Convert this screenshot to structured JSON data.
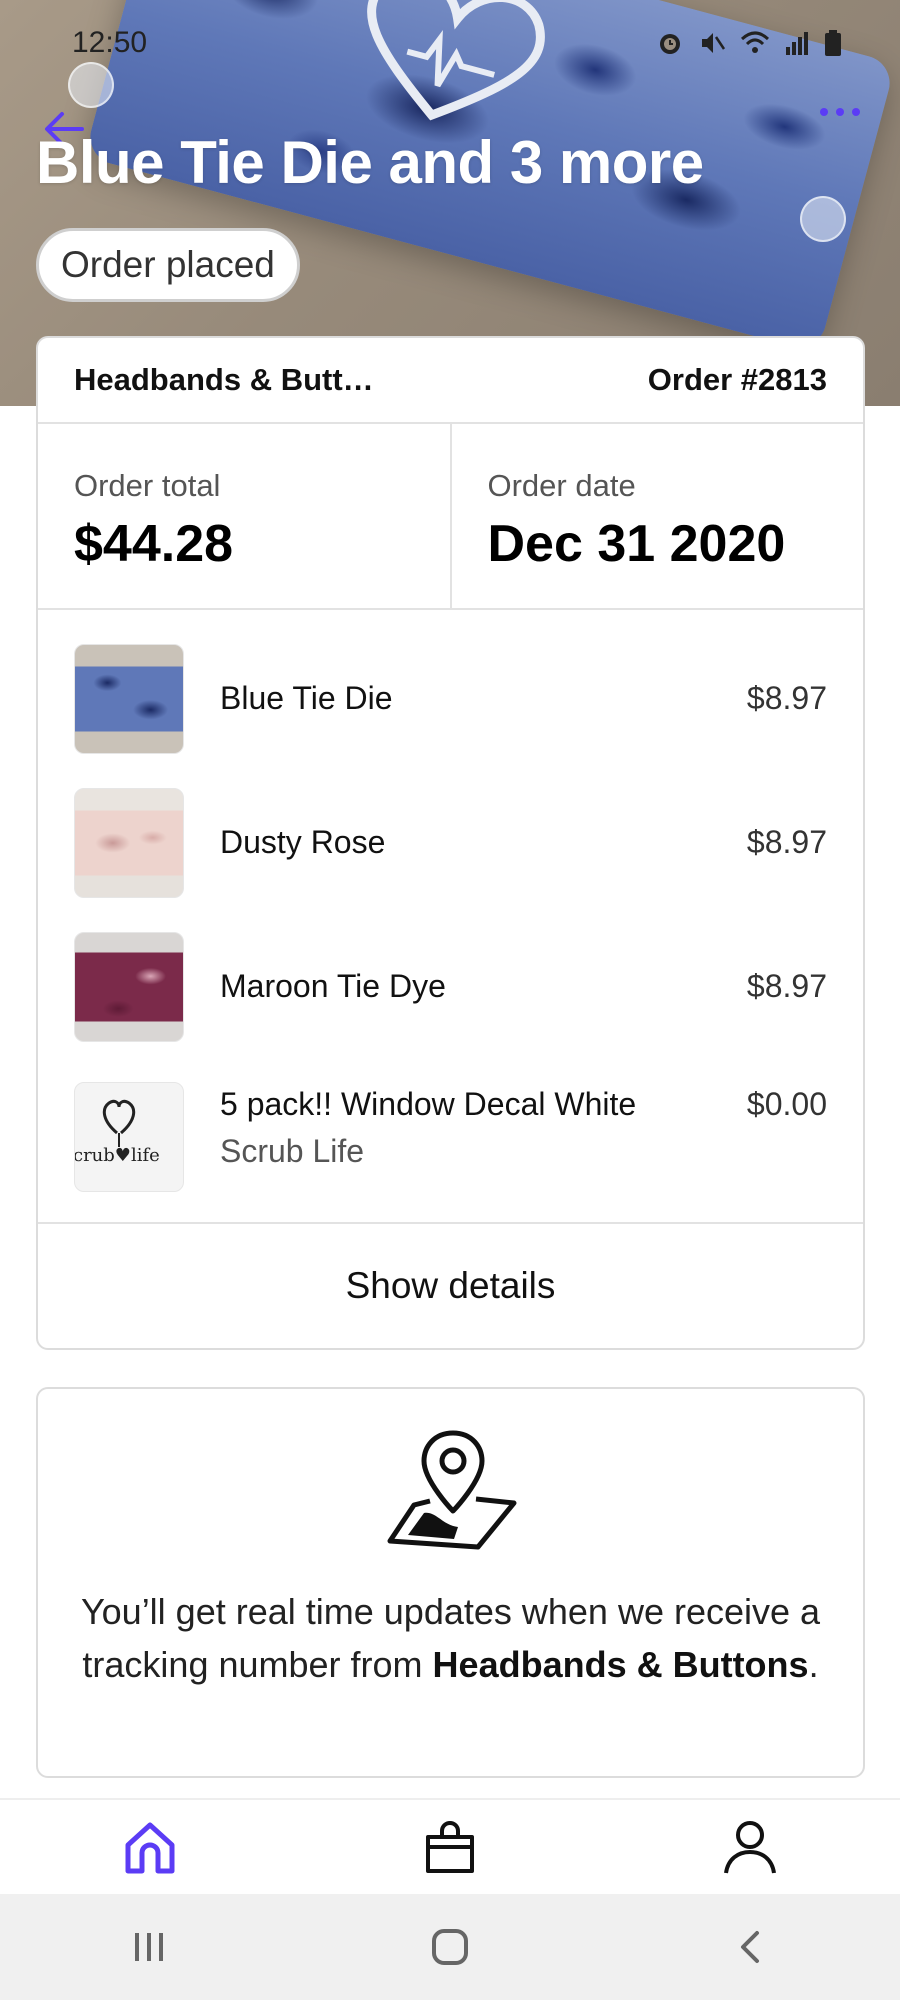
{
  "status_bar": {
    "time": "12:50"
  },
  "hero": {
    "title": "Blue Tie Die and 3 more",
    "status": "Order placed"
  },
  "order": {
    "store": "Headbands & Butt…",
    "number": "Order #2813",
    "total_label": "Order total",
    "total_value": "$44.28",
    "date_label": "Order date",
    "date_value": "Dec 31 2020",
    "items": [
      {
        "name": "Blue Tie Die",
        "subtitle": "",
        "price": "$8.97"
      },
      {
        "name": "Dusty Rose",
        "subtitle": "",
        "price": "$8.97"
      },
      {
        "name": "Maroon Tie Dye",
        "subtitle": "",
        "price": "$8.97"
      },
      {
        "name": "5 pack!! Window Decal White",
        "subtitle": "Scrub Life",
        "price": "$0.00"
      }
    ],
    "show_details": "Show details"
  },
  "tracking": {
    "message_start": "You’ll get real time updates when we receive a tracking number from ",
    "store_bold": "Headbands & Buttons",
    "message_end": "."
  },
  "decal_thumb_text": "crub♥life",
  "colors": {
    "accent": "#5b3cf5",
    "text": "#111111",
    "border": "#dcdcdc"
  },
  "tabs": [
    {
      "icon": "home-icon",
      "active": true
    },
    {
      "icon": "shopping-bag-icon",
      "active": false
    },
    {
      "icon": "person-icon",
      "active": false
    }
  ]
}
